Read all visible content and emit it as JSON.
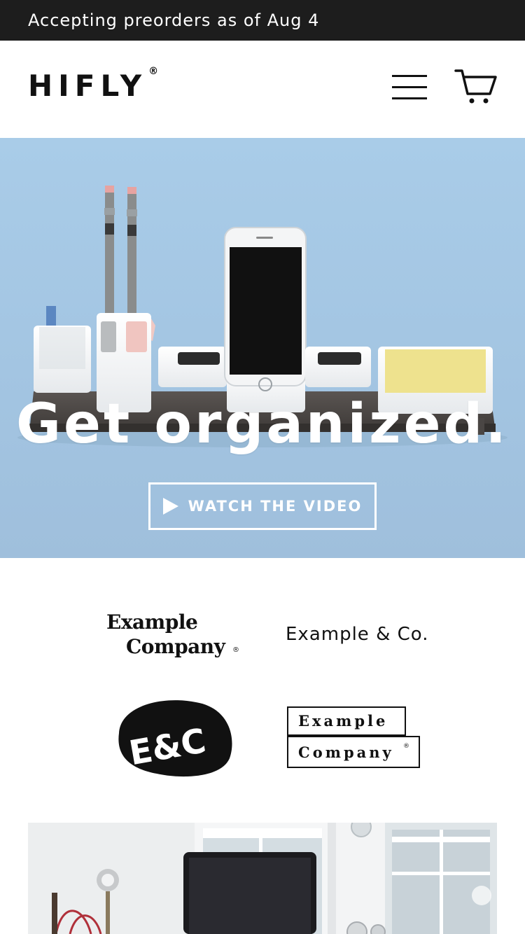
{
  "announcement": {
    "text": "Accepting preorders as of Aug 4"
  },
  "header": {
    "brand": "HIFLY",
    "brand_mark": "®",
    "icons": {
      "menu": "hamburger-icon",
      "cart": "cart-icon"
    }
  },
  "hero": {
    "title": "Get organized.",
    "video_button": {
      "label": "WATCH THE VIDEO",
      "icon": "play-icon"
    }
  },
  "press": {
    "logos": [
      {
        "line1": "Example",
        "line2": "Company",
        "mark": "®"
      },
      {
        "text": "Example & Co."
      },
      {
        "text": "E&C"
      },
      {
        "line1": "Example",
        "line2": "Company",
        "mark": "®"
      }
    ]
  },
  "colors": {
    "announcement_bg": "#1d1d1d",
    "hero_bg": "#a6c8e5",
    "text": "#111111",
    "white": "#ffffff"
  }
}
